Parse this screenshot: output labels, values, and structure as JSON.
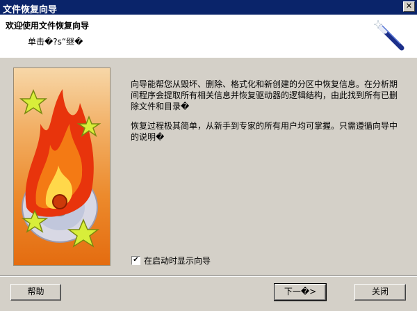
{
  "window": {
    "title": "文件恢复向导",
    "close_glyph": "✕"
  },
  "header": {
    "title": "欢迎使用文件恢复向导",
    "subtitle": "单击�?s“继�",
    "icon": "magic-wand-icon"
  },
  "side_image": {
    "icon": "flame-disc-stars-illustration"
  },
  "body": {
    "paragraph1": "向导能帮您从毁坏、删除、格式化和新创建的分区中恢复信息。在分析期间程序会提取所有相关信息并恢复驱动器的逻辑结构，由此找到所有已删除文件和目录�",
    "paragraph2": "恢复过程极其简单，从新手到专家的所有用户均可掌握。只需遵循向导中的说明�"
  },
  "checkbox": {
    "label": "在启动时显示向导",
    "checked": true,
    "mark": "✔"
  },
  "buttons": {
    "help": "帮助",
    "next": "下一�>",
    "close": "关闭"
  },
  "colors": {
    "titlebar": "#0a246a",
    "face": "#d4d0c8",
    "panel_orange": "#ec8a2c"
  }
}
